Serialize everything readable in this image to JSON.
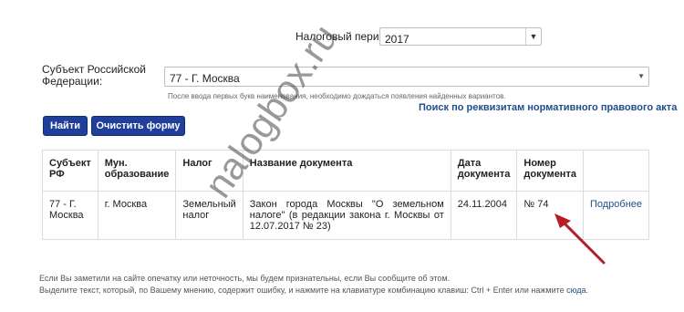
{
  "form": {
    "period_label": "Налоговый период:",
    "period_value": "2017",
    "subject_label": "Субъект Российской Федерации:",
    "subject_value": "77 - Г. Москва",
    "subject_hint": "После ввода первых букв наименования, необходимо дождаться появления найденных вариантов.",
    "search_by_details_link": "Поиск по реквизитам нормативного правового акта",
    "find_button": "Найти",
    "clear_button": "Очистить форму"
  },
  "table": {
    "headers": [
      "Субъект РФ",
      "Мун. образование",
      "Налог",
      "Название документа",
      "Дата документа",
      "Номер документа",
      ""
    ],
    "rows": [
      {
        "subject": "77 - Г. Москва",
        "municipality": "г. Москва",
        "tax": "Земельный налог",
        "doc_name": "Закон города Москвы \"О земельном налоге\" (в редакции закона г. Москвы от 12.07.2017 № 23)",
        "doc_date": "24.11.2004",
        "doc_number": "№ 74",
        "details_link": "Подробнее"
      }
    ]
  },
  "footer": {
    "line1": "Если Вы заметили на сайте опечатку или неточность, мы будем признательны, если Вы сообщите об этом.",
    "line2_prefix": "Выделите текст, который, по Вашему мнению, содержит ошибку, и нажмите на клавиатуре комбинацию клавиш: Ctrl + Enter или нажмите ",
    "line2_link": "сюда",
    "line2_suffix": "."
  },
  "watermark": "nalogbox.ru",
  "colors": {
    "button_bg": "#1f3f9a",
    "link": "#1f4e8c",
    "arrow": "#b81d24"
  },
  "icons": {
    "select_caret": "chevron-down-icon",
    "annotation": "red-arrow"
  }
}
